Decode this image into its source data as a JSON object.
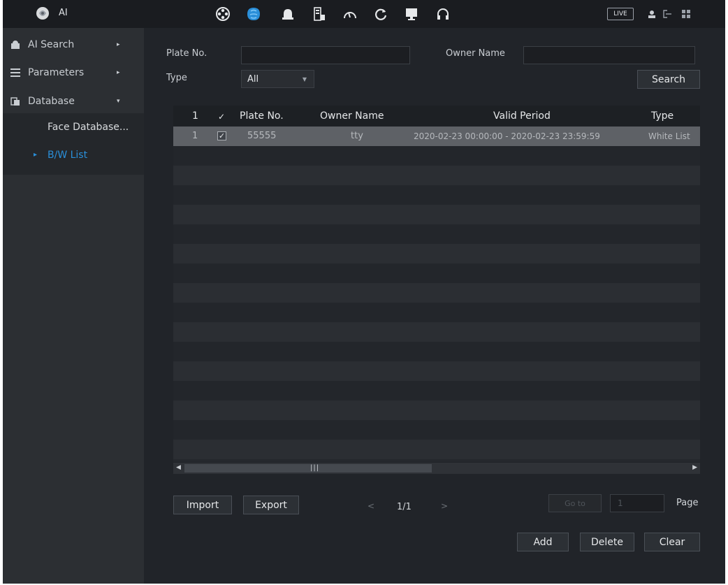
{
  "header": {
    "app_title": "AI",
    "live_label": "LIVE",
    "top_icons": [
      "playback-reel-icon",
      "ai-brain-icon",
      "alarm-bell-icon",
      "storage-drive-icon",
      "speed-gauge-icon",
      "refresh-sync-icon",
      "display-monitor-icon",
      "headset-support-icon"
    ],
    "active_icon": "ai-brain-icon",
    "accent_color": "#2a8fd9"
  },
  "sidebar": {
    "items": [
      {
        "label": "AI Search",
        "icon": "ai-search-icon"
      },
      {
        "label": "Parameters",
        "icon": "list-icon"
      },
      {
        "label": "Database",
        "icon": "database-icon"
      }
    ],
    "sub_items": [
      {
        "label": "Face Database..."
      },
      {
        "label": "B/W List",
        "active": true
      }
    ]
  },
  "filters": {
    "plate_label": "Plate No.",
    "plate_value": "",
    "owner_label": "Owner Name",
    "owner_value": "",
    "type_label": "Type",
    "type_value": "All",
    "search_label": "Search"
  },
  "table": {
    "headers": {
      "index": "1",
      "check": "✓",
      "plate": "Plate No.",
      "owner": "Owner Name",
      "period": "Valid Period",
      "type": "Type"
    },
    "rows": [
      {
        "index": "1",
        "checked": true,
        "plate": "55555",
        "owner": "tty",
        "period": "2020-02-23 00:00:00  -  2020-02-23 23:59:59",
        "type": "White List"
      }
    ]
  },
  "pagination": {
    "page_text": "1/1",
    "goto_label": "Go to",
    "page_input": "1",
    "page_label": "Page"
  },
  "actions": {
    "import": "Import",
    "export": "Export",
    "add": "Add",
    "delete": "Delete",
    "clear": "Clear"
  }
}
